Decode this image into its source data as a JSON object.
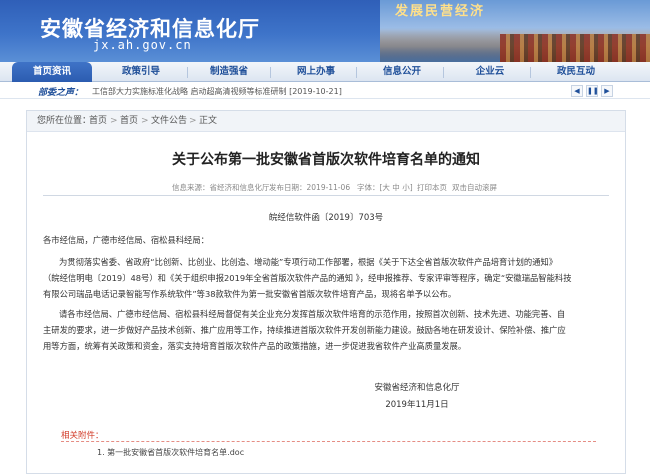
{
  "header": {
    "site_title": "安徽省经济和信息化厅",
    "site_domain": "jx.ah.gov.cn",
    "banner_text": "发展民营经济"
  },
  "nav": {
    "items": [
      {
        "label": "首页资讯",
        "active": true
      },
      {
        "label": "政策引导",
        "active": false
      },
      {
        "label": "制造强省",
        "active": false
      },
      {
        "label": "网上办事",
        "active": false
      },
      {
        "label": "信息公开",
        "active": false
      },
      {
        "label": "企业云",
        "active": false
      },
      {
        "label": "政民互动",
        "active": false
      }
    ]
  },
  "ticker": {
    "label": "部委之声：",
    "text": "工信部大力实施标准化战略 启动超高清视频等标准研制 [2019-10-21]",
    "prev_icon": "chevron-left-icon",
    "pause_icon": "pause-icon",
    "next_icon": "chevron-right-icon"
  },
  "breadcrumb": {
    "prefix": "您所在位置：",
    "items": [
      "首页",
      "首页",
      "文件公告",
      "正文"
    ],
    "separator": ">"
  },
  "article": {
    "title": "关于公布第一批安徽省首版次软件培育名单的通知",
    "meta": {
      "source": "信息来源：省经济和信息化厅",
      "date": "发布日期：2019-11-06",
      "font_size": "字体：[大 中 小]",
      "print": "打印本页",
      "auto_scroll": "双击自动滚屏"
    },
    "doc_no": "皖经信软件函〔2019〕703号",
    "salutation": "各市经信局，广德市经信局、宿松县科经局：",
    "para1_line1": "为贯彻落实省委、省政府“比创新、比创业、比创造、增动能”专项行动工作部署，根据《关于下达全省首版次软件产品培育计划的通知》",
    "para1_line2": "（皖经信明电〔2019〕48号）和《关于组织申报2019年全省首版次软件产品的通知 》，经申报推荐、专家评审等程序，确定“安徽瑞品智能科技",
    "para1_line3": "有限公司瑞品电话记录智能写作系统软件”等38款软件为第一批安徽省首版次软件培育产品，现将名单予以公布。",
    "para2_line1": "请各市经信局、广德市经信局、宿松县科经局督促有关企业充分发挥首版次软件培育的示范作用，按照首次创新、技术先进、功能完善、自",
    "para2_line2": "主研发的要求，进一步做好产品技术创新、推广应用等工作，持续推进首版次软件开发创新能力建设。鼓励各地在研发设计、保险补偿、推广应",
    "para2_line3": "用等方面，统筹有关政策和资金，落实支持培育首版次软件产品的政策措施，进一步促进我省软件产业高质量发展。",
    "signature": "安徽省经济和信息化厅",
    "sign_date": "2019年11月1日"
  },
  "attachments": {
    "title": "相关附件：",
    "items": [
      "1.  第一批安徽省首版次软件培育名单.doc"
    ]
  }
}
